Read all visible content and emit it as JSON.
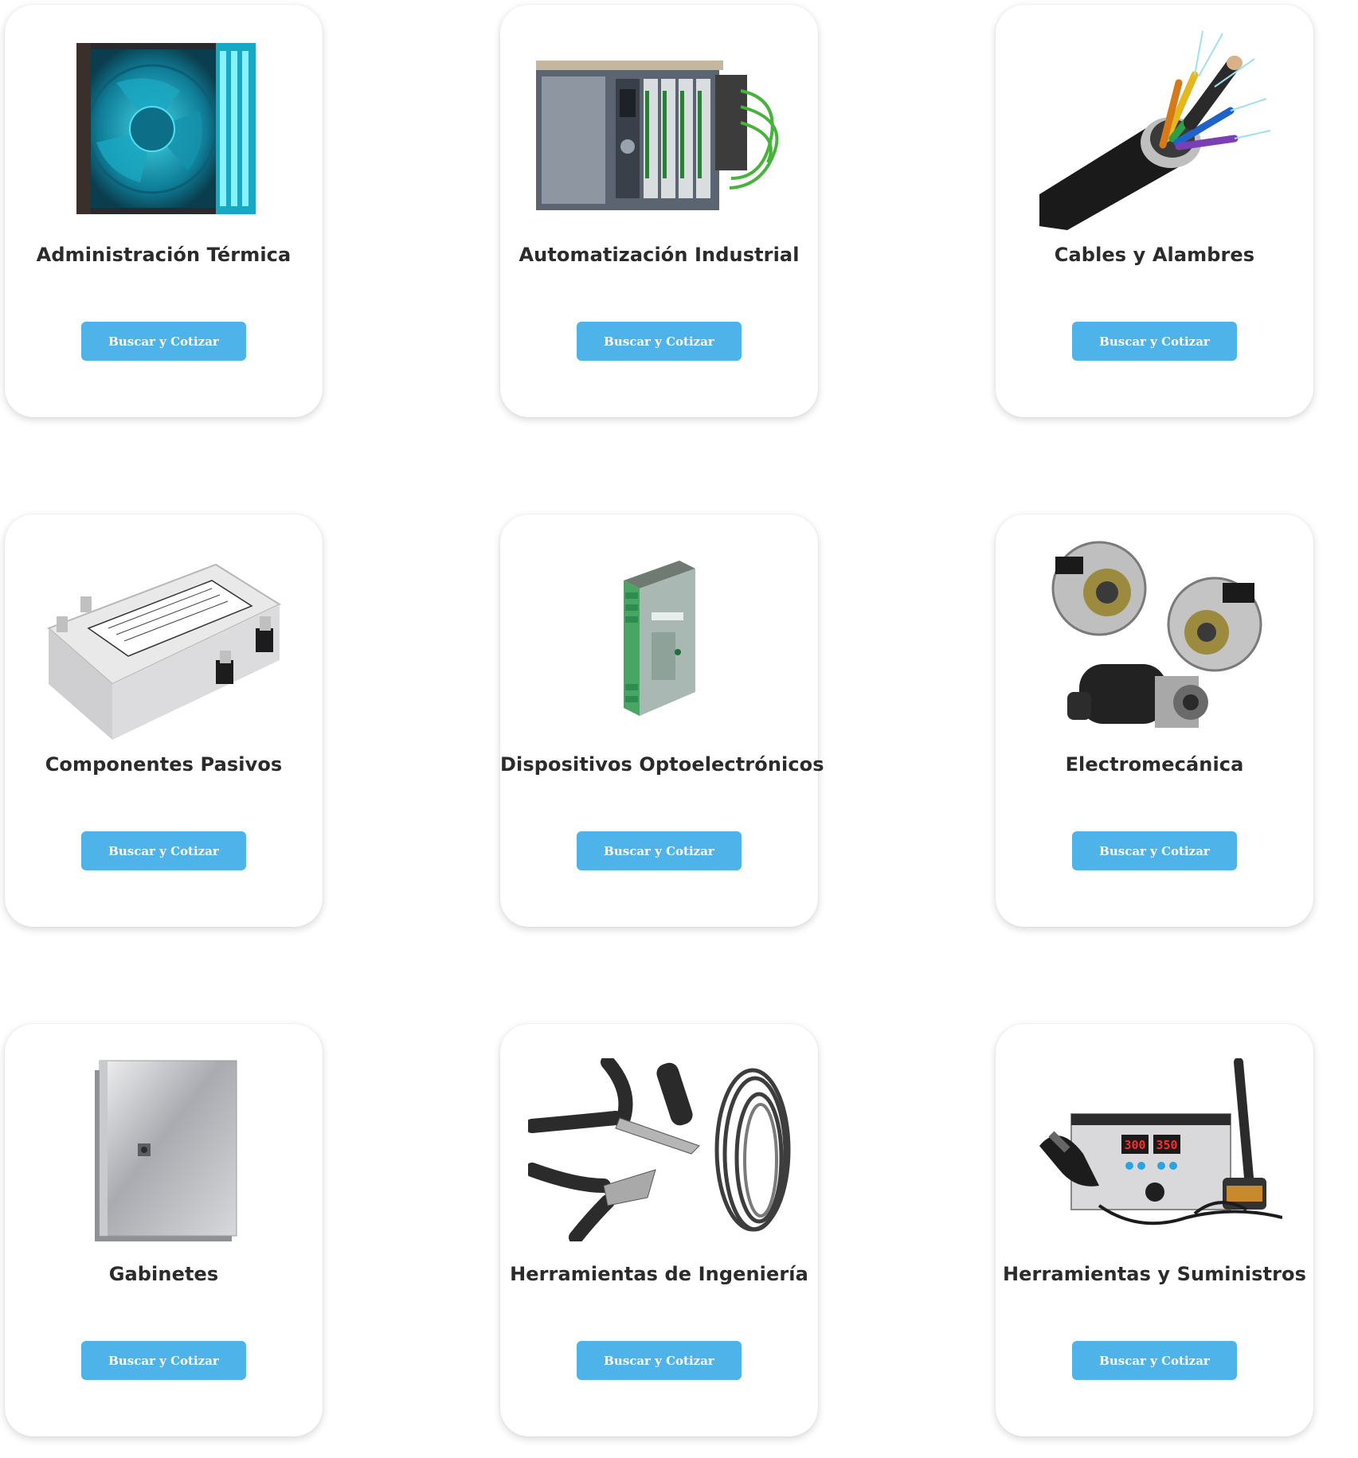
{
  "categories": [
    {
      "title": "Administración Térmica",
      "button_label": "Buscar y Cotizar",
      "image": "cooling-fan-icon"
    },
    {
      "title": "Automatización Industrial",
      "button_label": "Buscar y Cotizar",
      "image": "plc-module-icon"
    },
    {
      "title": "Cables y Alambres",
      "button_label": "Buscar y Cotizar",
      "image": "fiber-optic-cable-icon"
    },
    {
      "title": "Componentes Pasivos",
      "button_label": "Buscar y Cotizar",
      "image": "emi-filter-icon"
    },
    {
      "title": "Dispositivos Optoelectrónicos",
      "button_label": "Buscar y Cotizar",
      "image": "din-rail-power-supply-icon"
    },
    {
      "title": "Electromecánica",
      "button_label": "Buscar y Cotizar",
      "image": "alternator-starter-icon"
    },
    {
      "title": "Gabinetes",
      "button_label": "Buscar y Cotizar",
      "image": "steel-enclosure-icon"
    },
    {
      "title": "Herramientas de Ingeniería",
      "button_label": "Buscar y Cotizar",
      "image": "pliers-and-wire-icon"
    },
    {
      "title": "Herramientas y Suministros",
      "button_label": "Buscar y Cotizar",
      "image": "soldering-station-icon"
    }
  ],
  "soldering_station": {
    "display_left": "300",
    "display_right": "350"
  },
  "colors": {
    "button": "#4db3e8",
    "title_text": "#2b2b2b",
    "card_bg": "#ffffff"
  }
}
